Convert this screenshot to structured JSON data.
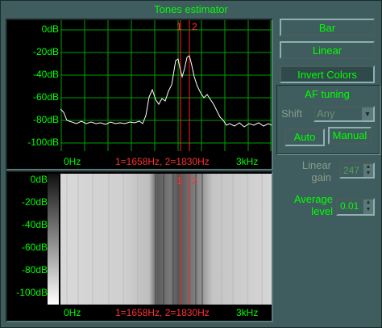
{
  "window": {
    "title": "Tones estimator"
  },
  "spectrum": {
    "y_labels": [
      "0dB",
      "-20dB",
      "-40dB",
      "-60dB",
      "-80dB",
      "-100dB"
    ],
    "x_labels": {
      "left": "0Hz",
      "marker": "1=1658Hz, 2=1830Hz",
      "right": "3kHz"
    },
    "marker_labels": [
      "1",
      "2"
    ],
    "colors": {
      "grid": "#00a000",
      "trace": "#ffffff",
      "marker": "#ff2020"
    }
  },
  "waterfall": {
    "y_labels": [
      "0dB",
      "-20dB",
      "-40dB",
      "-60dB",
      "-80dB",
      "-100dB"
    ],
    "x_labels": {
      "left": "0Hz",
      "marker": "1=1658Hz, 2=1830Hz",
      "right": "3kHz"
    },
    "marker_labels": [
      "1",
      "2"
    ]
  },
  "controls": {
    "bar_label": "Bar",
    "linear_label": "Linear",
    "invert_label": "Invert Colors",
    "af_tuning_title": "AF tuning",
    "shift_label": "Shift",
    "shift_value": "Any",
    "auto_label": "Auto",
    "manual_label": "Manual",
    "linear_gain_label": "Linear gain",
    "linear_gain_value": "247",
    "average_level_label": "Average level",
    "average_level_value": "0.01"
  }
}
